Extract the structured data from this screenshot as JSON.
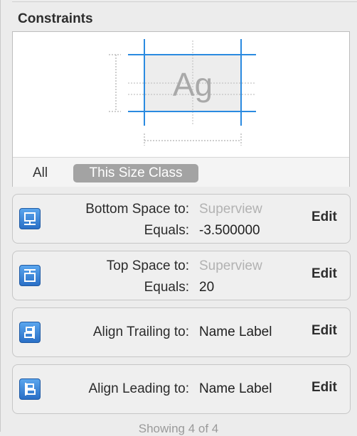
{
  "inspector": {
    "section_title": "Constraints",
    "preview": {
      "sample_text": "Ag"
    },
    "scope": {
      "all_label": "All",
      "size_class_label": "This Size Class"
    },
    "constraints": [
      {
        "icon": "bottom-space-icon",
        "first_label": "Bottom Space to:",
        "first_value": "Superview",
        "second_label": "Equals:",
        "second_value": "-3.500000",
        "edit_label": "Edit"
      },
      {
        "icon": "top-space-icon",
        "first_label": "Top Space to:",
        "first_value": "Superview",
        "second_label": "Equals:",
        "second_value": "20",
        "edit_label": "Edit"
      },
      {
        "icon": "align-trailing-icon",
        "first_label": "Align Trailing to:",
        "first_value": "Name Label",
        "edit_label": "Edit"
      },
      {
        "icon": "align-leading-icon",
        "first_label": "Align Leading to:",
        "first_value": "Name Label",
        "edit_label": "Edit"
      }
    ],
    "footer_status": "Showing 4 of 4"
  },
  "colors": {
    "accent_blue": "#2a8ae0",
    "muted_text": "#b2b2b2",
    "pill_gray": "#a3a3a3"
  }
}
